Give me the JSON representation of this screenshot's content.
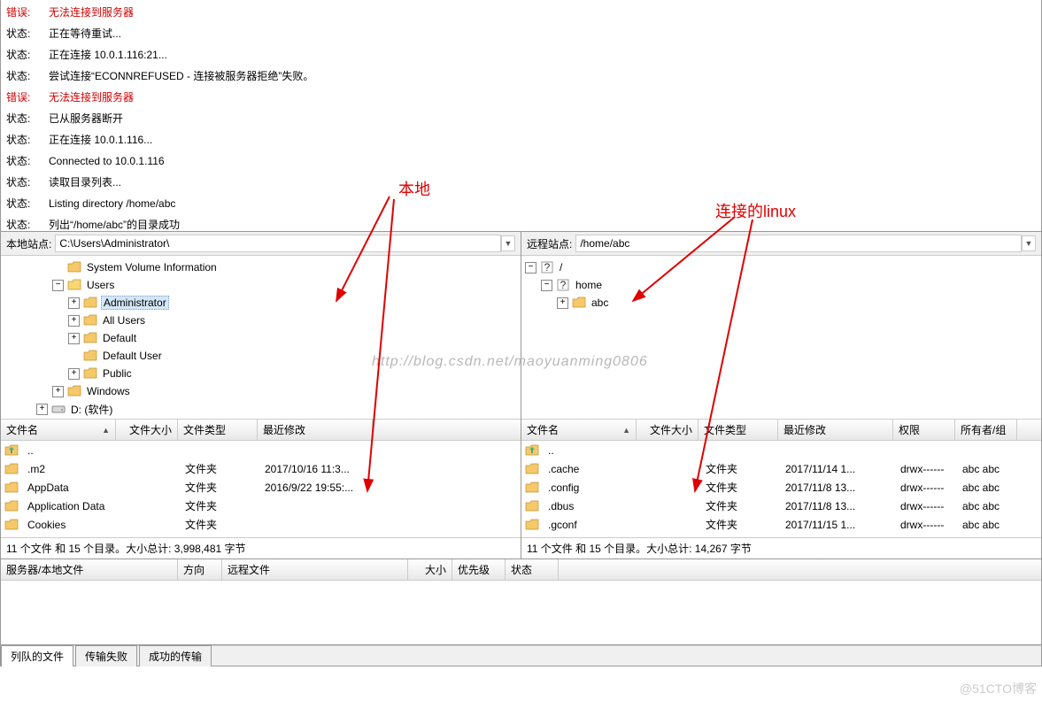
{
  "log": [
    {
      "type": "error",
      "label": "错误:",
      "text": "无法连接到服务器"
    },
    {
      "type": "status",
      "label": "状态:",
      "text": "正在等待重试..."
    },
    {
      "type": "status",
      "label": "状态:",
      "text": "正在连接 10.0.1.116:21..."
    },
    {
      "type": "status",
      "label": "状态:",
      "text": "尝试连接“ECONNREFUSED - 连接被服务器拒绝”失败。"
    },
    {
      "type": "error",
      "label": "错误:",
      "text": "无法连接到服务器"
    },
    {
      "type": "status",
      "label": "状态:",
      "text": "已从服务器断开"
    },
    {
      "type": "status",
      "label": "状态:",
      "text": "正在连接 10.0.1.116..."
    },
    {
      "type": "status",
      "label": "状态:",
      "text": "Connected to 10.0.1.116"
    },
    {
      "type": "status",
      "label": "状态:",
      "text": "读取目录列表..."
    },
    {
      "type": "status",
      "label": "状态:",
      "text": "Listing directory /home/abc"
    },
    {
      "type": "status",
      "label": "状态:",
      "text": "列出“/home/abc”的目录成功"
    }
  ],
  "localSite": {
    "label": "本地站点:",
    "path": "C:\\Users\\Administrator\\"
  },
  "remoteSite": {
    "label": "远程站点:",
    "path": "/home/abc"
  },
  "localTree": [
    {
      "depth": 3,
      "exp": "",
      "icon": "folder",
      "label": "System Volume Information"
    },
    {
      "depth": 3,
      "exp": "-",
      "icon": "folder-open",
      "label": "Users"
    },
    {
      "depth": 4,
      "exp": "+",
      "icon": "folder-user",
      "label": "Administrator",
      "selected": true
    },
    {
      "depth": 4,
      "exp": "+",
      "icon": "folder",
      "label": "All Users"
    },
    {
      "depth": 4,
      "exp": "+",
      "icon": "folder",
      "label": "Default"
    },
    {
      "depth": 4,
      "exp": "",
      "icon": "folder",
      "label": "Default User"
    },
    {
      "depth": 4,
      "exp": "+",
      "icon": "folder",
      "label": "Public"
    },
    {
      "depth": 3,
      "exp": "+",
      "icon": "folder",
      "label": "Windows"
    },
    {
      "depth": 2,
      "exp": "+",
      "icon": "drive",
      "label": "D: (软件)"
    }
  ],
  "remoteTree": [
    {
      "depth": 0,
      "exp": "-",
      "icon": "q",
      "label": "/"
    },
    {
      "depth": 1,
      "exp": "-",
      "icon": "q",
      "label": "home"
    },
    {
      "depth": 2,
      "exp": "+",
      "icon": "folder",
      "label": "abc"
    }
  ],
  "localListHeaders": [
    "文件名",
    "文件大小",
    "文件类型",
    "最近修改"
  ],
  "localList": [
    {
      "name": "..",
      "type": "",
      "mtime": "",
      "icon": "up"
    },
    {
      "name": ".m2",
      "type": "文件夹",
      "mtime": "2017/10/16 11:3...",
      "icon": "folder"
    },
    {
      "name": "AppData",
      "type": "文件夹",
      "mtime": "2016/9/22 19:55:...",
      "icon": "folder"
    },
    {
      "name": "Application Data",
      "type": "文件夹",
      "mtime": "",
      "icon": "folder"
    },
    {
      "name": "Cookies",
      "type": "文件夹",
      "mtime": "",
      "icon": "folder"
    }
  ],
  "localStatus": "11 个文件 和 15 个目录。大小总计: 3,998,481 字节",
  "remoteListHeaders": [
    "文件名",
    "文件大小",
    "文件类型",
    "最近修改",
    "权限",
    "所有者/组"
  ],
  "remoteList": [
    {
      "name": "..",
      "type": "",
      "mtime": "",
      "perm": "",
      "owner": "",
      "icon": "up"
    },
    {
      "name": ".cache",
      "type": "文件夹",
      "mtime": "2017/11/14 1...",
      "perm": "drwx------",
      "owner": "abc abc",
      "icon": "folder"
    },
    {
      "name": ".config",
      "type": "文件夹",
      "mtime": "2017/11/8 13...",
      "perm": "drwx------",
      "owner": "abc abc",
      "icon": "folder"
    },
    {
      "name": ".dbus",
      "type": "文件夹",
      "mtime": "2017/11/8 13...",
      "perm": "drwx------",
      "owner": "abc abc",
      "icon": "folder"
    },
    {
      "name": ".gconf",
      "type": "文件夹",
      "mtime": "2017/11/15 1...",
      "perm": "drwx------",
      "owner": "abc abc",
      "icon": "folder"
    }
  ],
  "remoteStatus": "11 个文件 和 15 个目录。大小总计: 14,267 字节",
  "queueHeaders": [
    "服务器/本地文件",
    "方向",
    "远程文件",
    "大小",
    "优先级",
    "状态"
  ],
  "tabs": [
    "列队的文件",
    "传输失败",
    "成功的传输"
  ],
  "annotations": {
    "local": "本地",
    "remote": "连接的linux"
  },
  "watermark": "http://blog.csdn.net/maoyuanming0806",
  "copyright": "@51CTO博客"
}
